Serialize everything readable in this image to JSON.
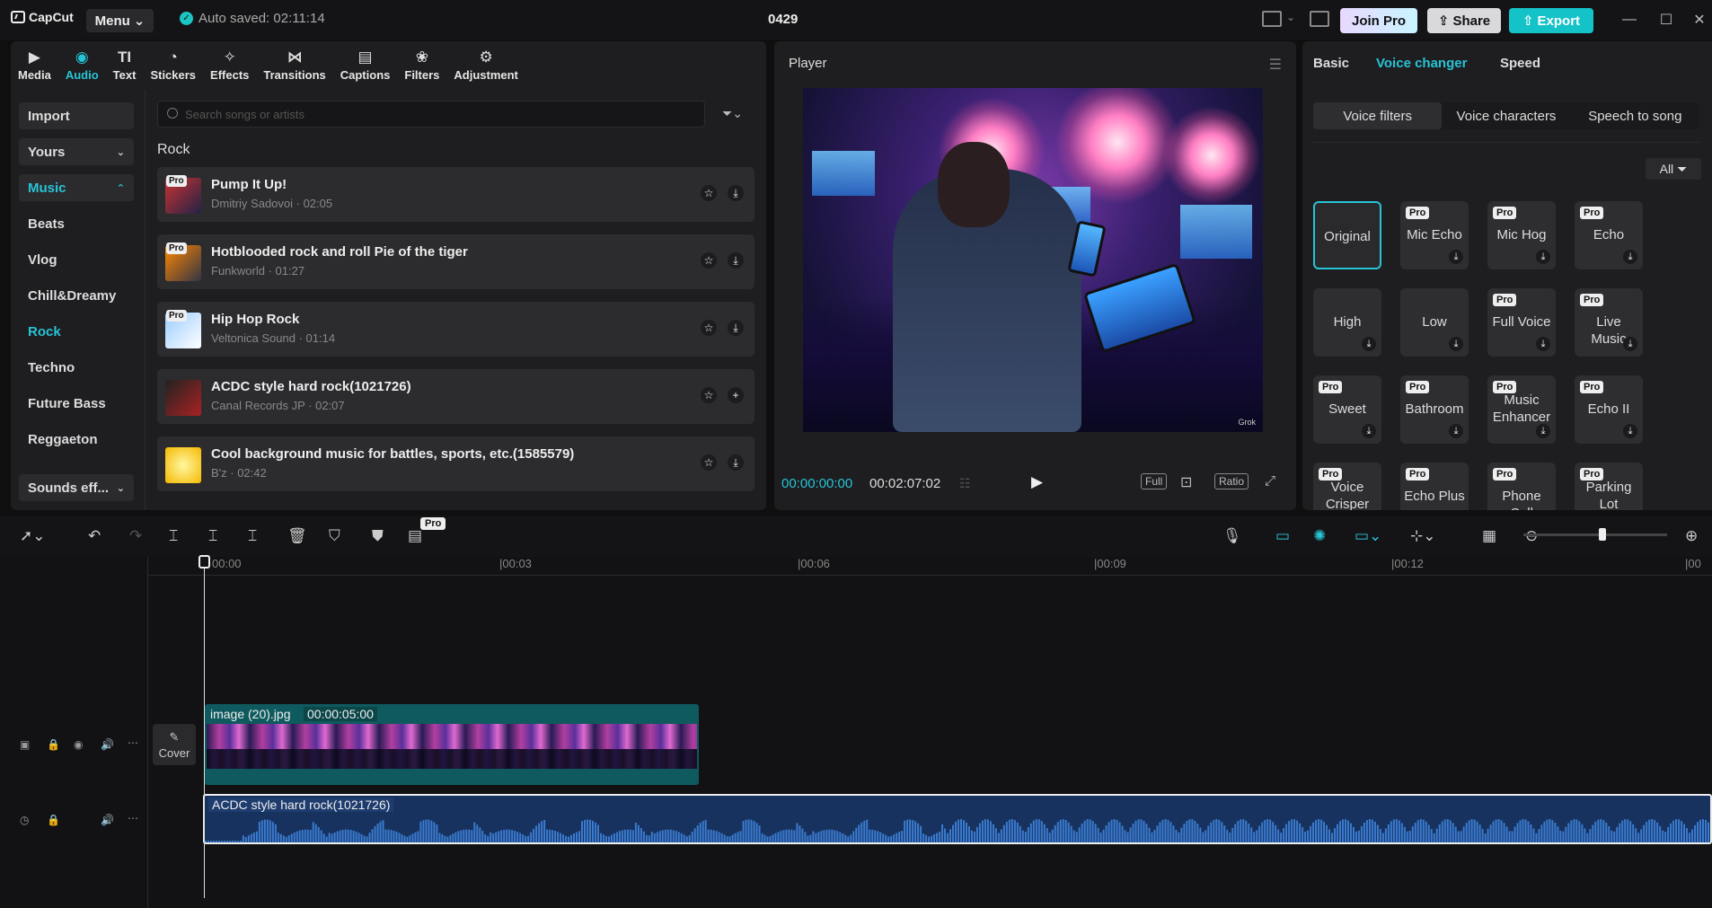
{
  "app": {
    "name": "CapCut",
    "menu_label": "Menu",
    "autosave": "Auto saved: 02:11:14",
    "project_title": "0429",
    "join_pro": "Join Pro",
    "share": "Share",
    "export": "Export"
  },
  "tool_tabs": [
    {
      "label": "Media",
      "icon": "media-icon",
      "glyph": "▶"
    },
    {
      "label": "Audio",
      "icon": "audio-icon",
      "glyph": "◉"
    },
    {
      "label": "Text",
      "icon": "text-icon",
      "glyph": "TI"
    },
    {
      "label": "Stickers",
      "icon": "stickers-icon",
      "glyph": "◔"
    },
    {
      "label": "Effects",
      "icon": "effects-icon",
      "glyph": "✧"
    },
    {
      "label": "Transitions",
      "icon": "transitions-icon",
      "glyph": "⋈"
    },
    {
      "label": "Captions",
      "icon": "captions-icon",
      "glyph": "▤"
    },
    {
      "label": "Filters",
      "icon": "filters-icon",
      "glyph": "❀"
    },
    {
      "label": "Adjustment",
      "icon": "adjustment-icon",
      "glyph": "⚙"
    }
  ],
  "categories": {
    "import": "Import",
    "yours": "Yours",
    "music": "Music",
    "items": [
      "Beats",
      "Vlog",
      "Chill&Dreamy",
      "Rock",
      "Techno",
      "Future Bass",
      "Reggaeton"
    ],
    "sounds": "Sounds eff..."
  },
  "search": {
    "placeholder": "Search songs or artists"
  },
  "section_title": "Rock",
  "songs": [
    {
      "title": "Pump It Up!",
      "meta": "Dmitriy Sadovoi · 02:05",
      "pro": "Pro"
    },
    {
      "title": "Hotblooded rock and roll Pie of the tiger",
      "meta": "Funkworld · 01:27",
      "pro": "Pro"
    },
    {
      "title": "Hip Hop Rock",
      "meta": "Veltonica Sound · 01:14",
      "pro": "Pro"
    },
    {
      "title": "ACDC style hard rock(1021726)",
      "meta": "Canal Records JP · 02:07",
      "pro": ""
    },
    {
      "title": "Cool background music for battles, sports, etc.(1585579)",
      "meta": "B'z · 02:42",
      "pro": ""
    }
  ],
  "player": {
    "title": "Player",
    "current_time": "00:00:00:00",
    "total_time": "00:02:07:02",
    "full": "Full",
    "ratio": "Ratio",
    "watermark": "Grok"
  },
  "right_panel": {
    "tabs": [
      "Basic",
      "Voice changer",
      "Speed"
    ],
    "subtabs": [
      "Voice filters",
      "Voice characters",
      "Speech to song"
    ],
    "all_filter": "All",
    "voice_filters": [
      {
        "name": "Original",
        "pro": false
      },
      {
        "name": "Mic Echo",
        "pro": true
      },
      {
        "name": "Mic Hog",
        "pro": true
      },
      {
        "name": "Echo",
        "pro": true
      },
      {
        "name": "High",
        "pro": false
      },
      {
        "name": "Low",
        "pro": false
      },
      {
        "name": "Full Voice",
        "pro": true
      },
      {
        "name": "Live Music",
        "pro": true
      },
      {
        "name": "Sweet",
        "pro": true
      },
      {
        "name": "Bathroom",
        "pro": true
      },
      {
        "name": "Music Enhancer",
        "pro": true
      },
      {
        "name": "Echo II",
        "pro": true
      },
      {
        "name": "Voice Crisper",
        "pro": true
      },
      {
        "name": "Echo Plus",
        "pro": true
      },
      {
        "name": "Phone Call",
        "pro": true
      },
      {
        "name": "Parking Lot",
        "pro": true
      }
    ],
    "pro_label": "Pro"
  },
  "toolbar": {
    "pro_badge": "Pro"
  },
  "timeline": {
    "ticks": [
      "00:00",
      "|00:03",
      "|00:06",
      "|00:09",
      "|00:12",
      "|00"
    ],
    "cover_label": "Cover",
    "video_clip_name": "image (20).jpg",
    "video_clip_duration": "00:00:05:00",
    "audio_clip_name": "ACDC style hard rock(1021726)"
  },
  "colors": {
    "accent": "#27c4d6",
    "export": "#14c3c8"
  }
}
